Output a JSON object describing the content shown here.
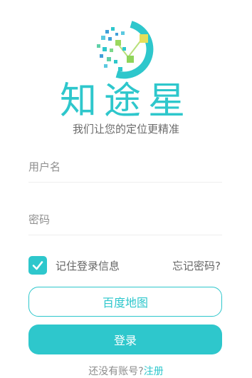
{
  "brand": {
    "title": "知途星",
    "slogan": "我们让您的定位更精准",
    "logo_icon": "star-orbit-logo-icon",
    "accent_color": "#2ec7cc"
  },
  "form": {
    "username_placeholder": "用户名",
    "password_placeholder": "密码",
    "remember_label": "记住登录信息",
    "remember_checked": true,
    "forgot_label": "忘记密码?"
  },
  "buttons": {
    "map_label": "百度地图",
    "login_label": "登录"
  },
  "footer": {
    "no_account_text": "还没有账号?",
    "register_link": "注册"
  }
}
